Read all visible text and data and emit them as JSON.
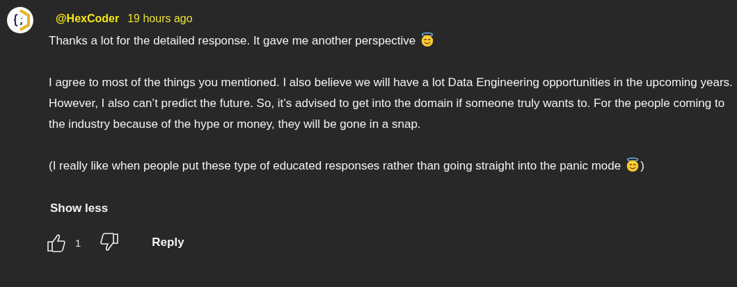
{
  "comment": {
    "author": "@HexCoder",
    "time": "19 hours ago",
    "paragraphs": [
      {
        "text": "Thanks a lot for the detailed response. It gave me another perspective",
        "emoji": true
      },
      {
        "text": "I agree to most of the things you mentioned. I also believe we will have a lot Data Engineering opportunities in the upcoming years. However, I also can’t predict the future. So, it’s advised to get into the domain if someone truly wants to. For the people coming to the industry because of the hype or money, they will be gone in a snap.",
        "emoji": false
      },
      {
        "text": "(I really like when people put these type of educated responses rather than going straight into the panic mode",
        "emoji": true,
        "after": ")"
      }
    ],
    "toggle": "Show less",
    "likes": "1",
    "reply": "Reply"
  }
}
